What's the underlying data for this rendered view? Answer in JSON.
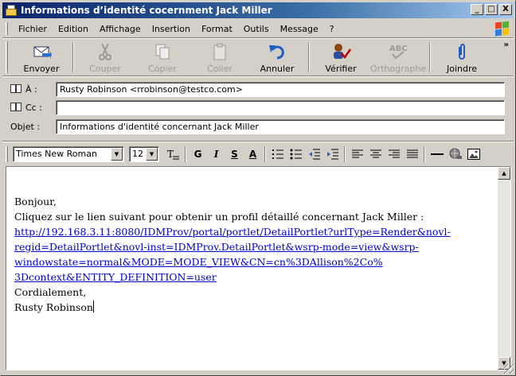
{
  "window": {
    "title": "Informations d’identité cocernment Jack Miller",
    "minimize": "_",
    "maximize": "□",
    "close": "X"
  },
  "menu": [
    {
      "label": "Fichier"
    },
    {
      "label": "Edition"
    },
    {
      "label": "Affichage"
    },
    {
      "label": "Insertion"
    },
    {
      "label": "Format"
    },
    {
      "label": "Outils"
    },
    {
      "label": "Message"
    },
    {
      "label": "?"
    }
  ],
  "toolbar": {
    "send": "Envoyer",
    "cut": "Couper",
    "copy": "Copier",
    "paste": "Coller",
    "undo": "Annuler",
    "check": "Vérifier",
    "spelling": "Orthographe",
    "attach": "Joindre",
    "more": "»"
  },
  "fields": {
    "to_label": "À :",
    "to_value": "Rusty Robinson <rrobinson@testco.com>",
    "cc_label": "Cc :",
    "cc_value": "",
    "subject_label": "Objet :",
    "subject_value": "Informations d'identité concernant Jack Miller"
  },
  "format": {
    "font": "Times New Roman",
    "size": "12",
    "bold": "G",
    "italic": "I",
    "underline": "S",
    "color": "A"
  },
  "body": {
    "greeting": "Bonjour,",
    "line1": "Cliquez sur le lien suivant pour obtenir un profil détaillé concernant Jack Miller :",
    "link_line1": "http://192.168.3.11:8080/IDMProv/portal/portlet/DetailPortlet?urlType=Render&novl-",
    "link_line2": "regid=DetailPortlet&novl-inst=IDMProv.DetailPortlet&wsrp-mode=view&wsrp-",
    "link_line3": "windowstate=normal&MODE=MODE_VIEW&CN=cn%3DAllison%2Co%",
    "link_line4": "3Dcontext&ENTITY_DEFINITION=user",
    "closing": "Cordialement,",
    "signature": "Rusty Robinson"
  }
}
